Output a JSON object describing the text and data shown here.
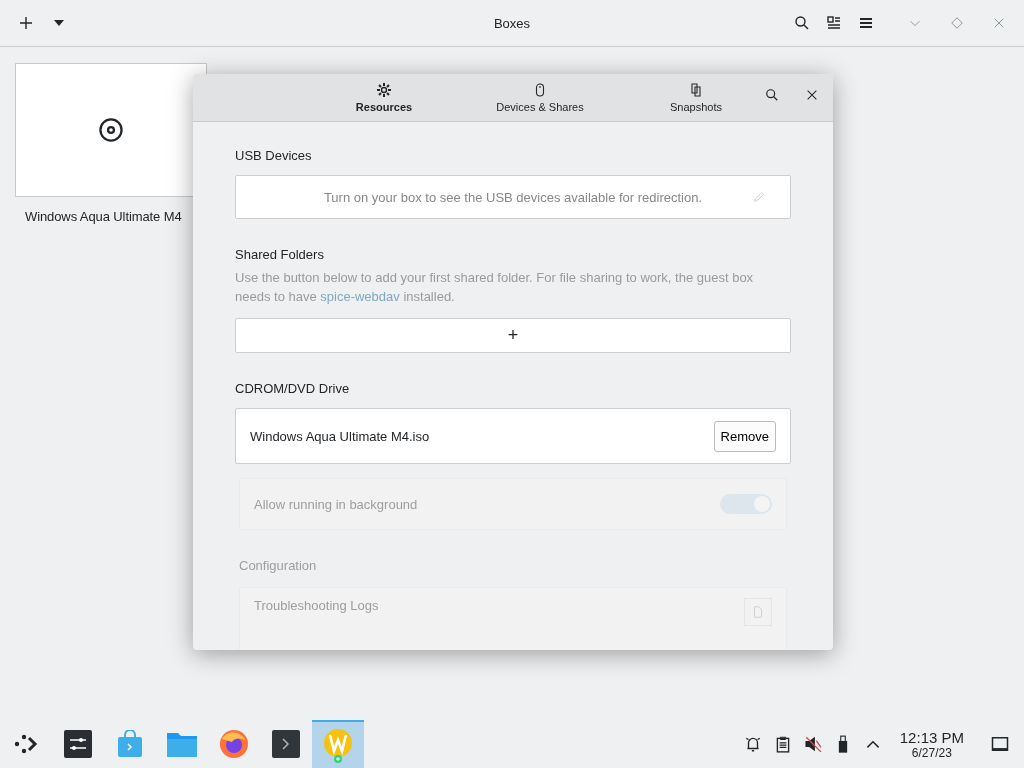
{
  "window": {
    "title": "Boxes"
  },
  "boxes": [
    {
      "name": "Windows Aqua Ultimate M4"
    }
  ],
  "dialog": {
    "tabs": [
      {
        "label": "Resources",
        "selected": true
      },
      {
        "label": "Devices & Shares",
        "selected": false
      },
      {
        "label": "Snapshots",
        "selected": false
      }
    ],
    "usb": {
      "heading": "USB Devices",
      "message": "Turn on your box to see the USB devices available for redirection."
    },
    "shared": {
      "heading": "Shared Folders",
      "description_before": "Use the button below to add your first shared folder. For file sharing to work, the guest box needs to have ",
      "link": "spice-webdav",
      "description_after": " installed.",
      "add_button": "+"
    },
    "cdrom": {
      "heading": "CDROM/DVD Drive",
      "file": "Windows Aqua Ultimate M4.iso",
      "button": "Remove"
    },
    "fading": {
      "toggle_label": "Allow running in background",
      "toggle_on": true,
      "heading": "Configuration",
      "row_title": "Troubleshooting Logs"
    }
  },
  "taskbar": {
    "time": "12:13 PM",
    "date": "6/27/23"
  }
}
